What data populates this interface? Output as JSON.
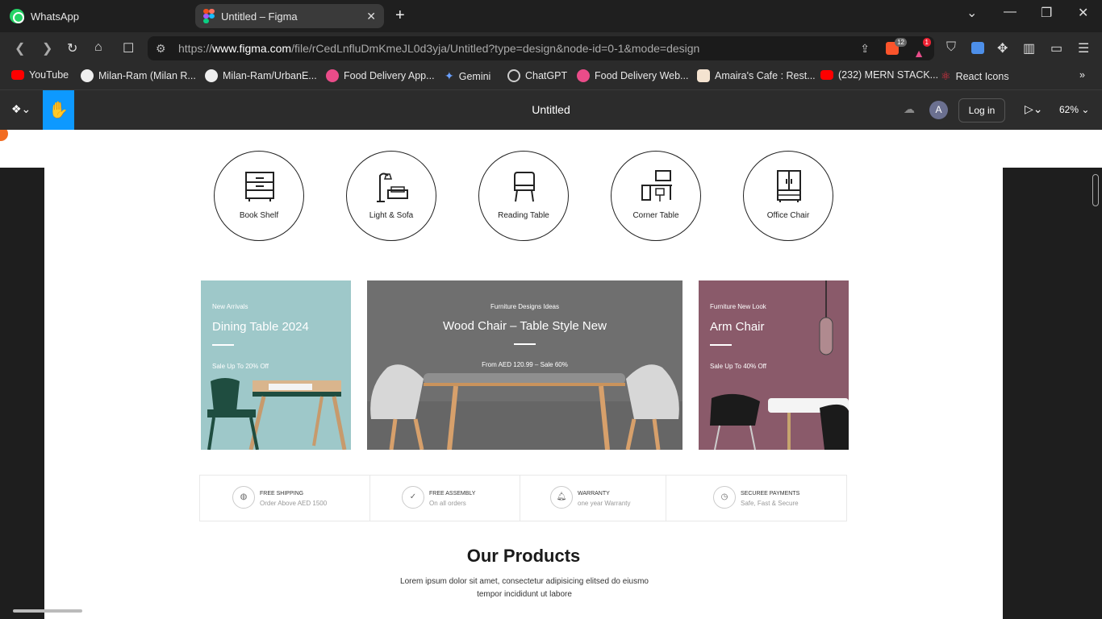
{
  "tabs": [
    {
      "title": "WhatsApp"
    },
    {
      "title": "Untitled – Figma"
    }
  ],
  "address": {
    "prefix": "https://",
    "host": "www.figma.com",
    "path": "/file/rCedLnfluDmKmeJL0d3yja/Untitled?type=design&node-id=0-1&mode=design"
  },
  "badges": {
    "brave": "12",
    "alerts": "1"
  },
  "bookmarks": [
    "YouTube",
    "Milan-Ram (Milan R...",
    "Milan-Ram/UrbanE...",
    "Food Delivery App...",
    "Gemini",
    "ChatGPT",
    "Food Delivery Web...",
    "Amaira's Cafe : Rest...",
    "(232) MERN STACK...",
    "React Icons"
  ],
  "figma": {
    "title": "Untitled",
    "avatar": "A",
    "login": "Log in",
    "zoom": "62%"
  },
  "categories": [
    "Book Shelf",
    "Light & Sofa",
    "Reading Table",
    "Corner Table",
    "Office Chair"
  ],
  "banners": [
    {
      "kicker": "New Arrivals",
      "title": "Dining Table 2024",
      "sale": "Sale Up To 20% Off"
    },
    {
      "kicker": "Furniture Designs Ideas",
      "title": "Wood Chair – Table Style New",
      "sale": "From AED 120.99 – Sale 60%"
    },
    {
      "kicker": "Furniture New Look",
      "title": "Arm Chair",
      "sale": "Sale Up To 40% Off"
    }
  ],
  "features": [
    {
      "title": "FREE SHIPPING",
      "desc": "Order Above AED 1500"
    },
    {
      "title": "FREE ASSEMBLY",
      "desc": "On all orders"
    },
    {
      "title": "WARRANTY",
      "desc": "one year Warranty"
    },
    {
      "title": "SECUREE PAYMENTS",
      "desc": "Safe, Fast & Secure"
    }
  ],
  "products": {
    "heading": "Our Products",
    "desc": "Lorem ipsum dolor sit amet, consectetur adipisicing elitsed do eiusmo tempor incididunt ut labore"
  },
  "colors": {
    "accent": "#0d99ff",
    "banner1": "#9ec8c9",
    "banner2": "#6f6f6f",
    "banner3": "#8a5a6a"
  }
}
